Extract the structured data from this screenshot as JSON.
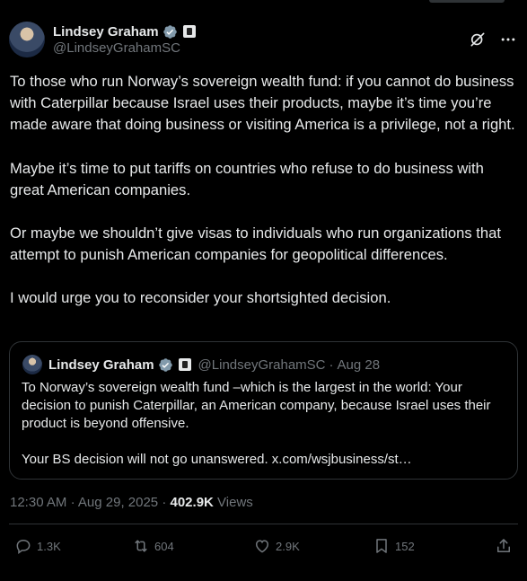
{
  "author": {
    "name": "Lindsey Graham",
    "handle": "@LindseyGrahamSC"
  },
  "post": {
    "paragraphs": [
      "To those who run Norway’s sovereign wealth fund: if you cannot do business with Caterpillar because Israel uses their products, maybe it’s time you’re made aware that doing business or visiting America is a privilege, not a right.",
      "Maybe it’s time to put tariffs on countries who refuse to do business with great American companies.",
      "Or maybe we shouldn’t give visas to individuals who run organizations that attempt to punish American companies for geopolitical differences.",
      "I would urge you to reconsider your shortsighted decision."
    ]
  },
  "quote": {
    "name": "Lindsey Graham",
    "handle": "@LindseyGrahamSC",
    "date": "Aug 28",
    "paragraphs": [
      "To Norway’s sovereign wealth fund –which is the largest in the world: Your decision to punish Caterpillar, an American company, because Israel uses their product is beyond offensive.",
      "Your BS decision will not go unanswered. x.com/wsjbusiness/st…"
    ]
  },
  "meta": {
    "time": "12:30 AM",
    "date": "Aug 29, 2025",
    "views_count": "402.9K",
    "views_label": "Views"
  },
  "actions": {
    "replies": "1.3K",
    "reposts": "604",
    "likes": "2.9K",
    "bookmarks": "152"
  },
  "colors": {
    "background": "#000000",
    "text": "#e7e9ea",
    "secondary": "#71767b",
    "border": "#2f3336",
    "verified": "#829aab"
  },
  "icons": [
    "verified-badge-icon",
    "government-badge-icon",
    "grok-icon",
    "reply-icon",
    "repost-icon",
    "like-icon",
    "bookmark-icon",
    "share-icon"
  ]
}
